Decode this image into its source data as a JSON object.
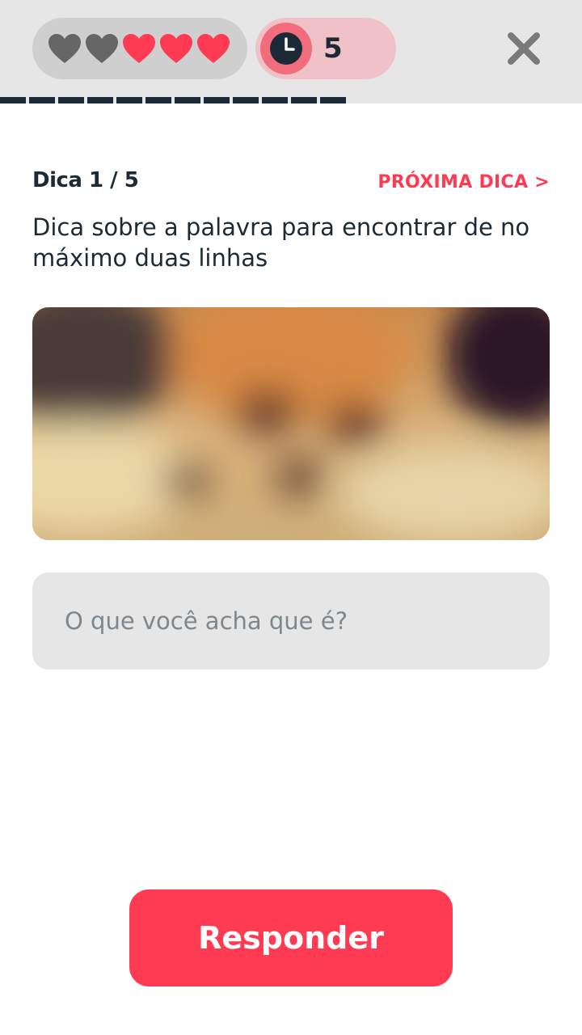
{
  "header": {
    "lives": {
      "total": 5,
      "lost": 2,
      "filled_color": "#ff3b53",
      "empty_color": "#666666"
    },
    "timer": {
      "icon": "clock-icon",
      "value": "5"
    },
    "close": {
      "icon": "close-icon"
    }
  },
  "progress": {
    "segments_filled": 12
  },
  "hint": {
    "counter": "Dica 1 / 5",
    "next_label": "PRÓXIMA DICA >",
    "text": "Dica sobre a palavra para encontrar de no máximo duas linhas",
    "image": "blurred-dog-photo"
  },
  "answer": {
    "placeholder": "O que você acha que é?",
    "value": ""
  },
  "actions": {
    "submit_label": "Responder"
  },
  "colors": {
    "accent": "#ff3b53",
    "dark": "#1b2a36",
    "surface": "#e6e6e6"
  }
}
